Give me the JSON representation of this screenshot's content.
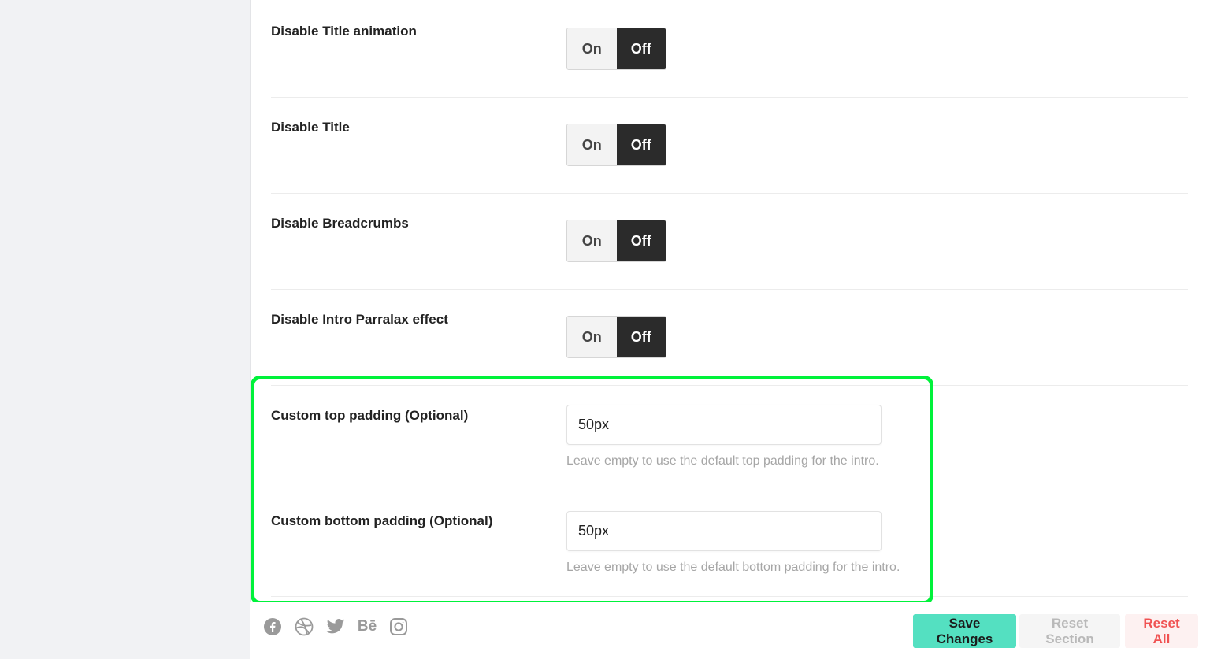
{
  "settings": {
    "rows": [
      {
        "label": "Disable Title animation",
        "on_label": "On",
        "off_label": "Off",
        "value": "Off"
      },
      {
        "label": "Disable Title",
        "on_label": "On",
        "off_label": "Off",
        "value": "Off"
      },
      {
        "label": "Disable Breadcrumbs",
        "on_label": "On",
        "off_label": "Off",
        "value": "Off"
      },
      {
        "label": "Disable Intro Parralax effect",
        "on_label": "On",
        "off_label": "Off",
        "value": "Off"
      }
    ],
    "top_padding": {
      "label": "Custom top padding (Optional)",
      "value": "50px",
      "description": "Leave empty to use the default top padding for the intro."
    },
    "bottom_padding": {
      "label": "Custom bottom padding (Optional)",
      "value": "50px",
      "description": "Leave empty to use the default bottom padding for the intro."
    }
  },
  "footer": {
    "social_icons": [
      "facebook-icon",
      "dribbble-icon",
      "twitter-icon",
      "behance-icon",
      "instagram-icon"
    ],
    "behance_text": "Bē",
    "save_label": "Save Changes",
    "reset_section_label": "Reset Section",
    "reset_all_label": "Reset All"
  },
  "colors": {
    "highlight": "#00f23a",
    "save_button": "#54e0c1",
    "reset_all_text": "#f05252",
    "toggle_active": "#2b2b2b"
  }
}
